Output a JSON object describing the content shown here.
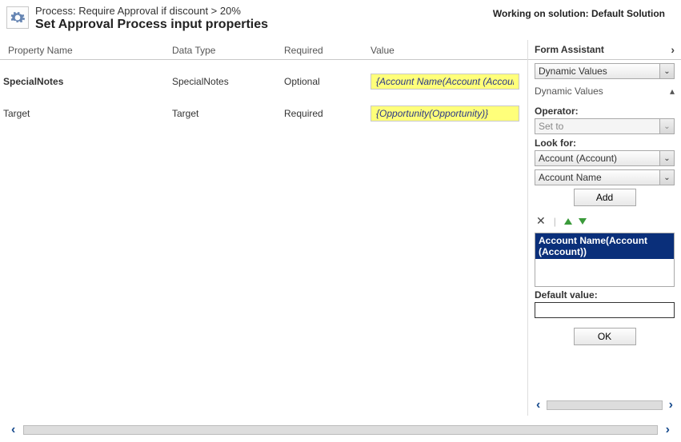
{
  "header": {
    "process_prefix": "Process: ",
    "process_name": "Require Approval if discount > 20%",
    "title": "Set Approval Process input properties",
    "working_prefix": "Working on solution: ",
    "solution_name": "Default Solution"
  },
  "columns": {
    "property": "Property Name",
    "datatype": "Data Type",
    "required": "Required",
    "value": "Value"
  },
  "rows": [
    {
      "property": "SpecialNotes",
      "datatype": "SpecialNotes",
      "required": "Optional",
      "value": "{Account Name(Account (Account))}"
    },
    {
      "property": "Target",
      "datatype": "Target",
      "required": "Required",
      "value": "{Opportunity(Opportunity)}"
    }
  ],
  "assistant": {
    "title": "Form Assistant",
    "dropdown_value": "Dynamic Values",
    "section_label": "Dynamic Values",
    "operator_label": "Operator:",
    "operator_value": "Set to",
    "lookfor_label": "Look for:",
    "lookfor_entity": "Account (Account)",
    "lookfor_field": "Account Name",
    "add_button": "Add",
    "listbox": [
      "Account Name(Account (Account))"
    ],
    "default_label": "Default value:",
    "default_value": "",
    "ok_button": "OK"
  }
}
